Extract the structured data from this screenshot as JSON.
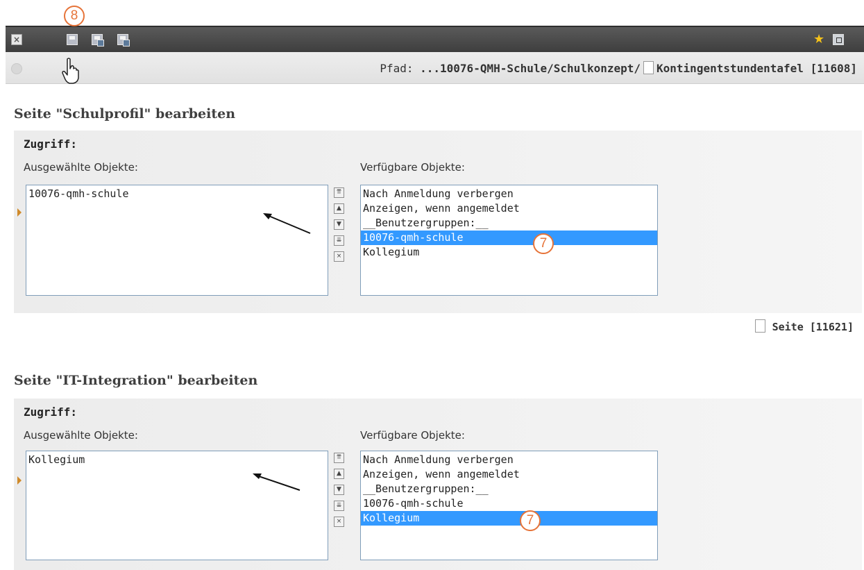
{
  "toolbar": {
    "close_icon": "close-icon",
    "save_icon": "save-icon",
    "save_close_icon": "save-close-icon",
    "save_cancel_icon": "save-cancel-icon",
    "favorite_icon": "star-icon",
    "fullscreen_icon": "fullscreen-icon",
    "close_glyph": "×",
    "star_glyph": "★"
  },
  "path": {
    "label": "Pfad:",
    "value": "...10076-QMH-Schule/Schulkonzept/",
    "page": "Kontingentstundentafel [11608]"
  },
  "annotations": {
    "save": "8",
    "select_first": "7",
    "select_second": "7"
  },
  "sections": [
    {
      "title": "Seite \"Schulprofil\" bearbeiten",
      "access_label": "Zugriff:",
      "selected_label": "Ausgewählte Objekte:",
      "available_label": "Verfügbare Objekte:",
      "selected_items": [
        "10076-qmh-schule"
      ],
      "available_items": [
        "Nach Anmeldung verbergen",
        "Anzeigen, wenn angemeldet",
        "__Benutzergruppen:__",
        "10076-qmh-schule",
        "Kollegium"
      ],
      "highlighted": "10076-qmh-schule"
    },
    {
      "title": "Seite \"IT-Integration\" bearbeiten",
      "access_label": "Zugriff:",
      "selected_label": "Ausgewählte Objekte:",
      "available_label": "Verfügbare Objekte:",
      "selected_items": [
        "Kollegium"
      ],
      "available_items": [
        "Nach Anmeldung verbergen",
        "Anzeigen, wenn angemeldet",
        "__Benutzergruppen:__",
        "10076-qmh-schule",
        "Kollegium"
      ],
      "highlighted": "Kollegium"
    }
  ],
  "page_link": "Seite [11621]",
  "list_buttons": {
    "top_glyph": "⇈",
    "up_glyph": "▲",
    "down_glyph": "▼",
    "bottom_glyph": "⇊",
    "remove_glyph": "×"
  },
  "colors": {
    "toolbar": "#4a4a4a",
    "selection": "#3399ff",
    "annotation": "#e67338"
  }
}
